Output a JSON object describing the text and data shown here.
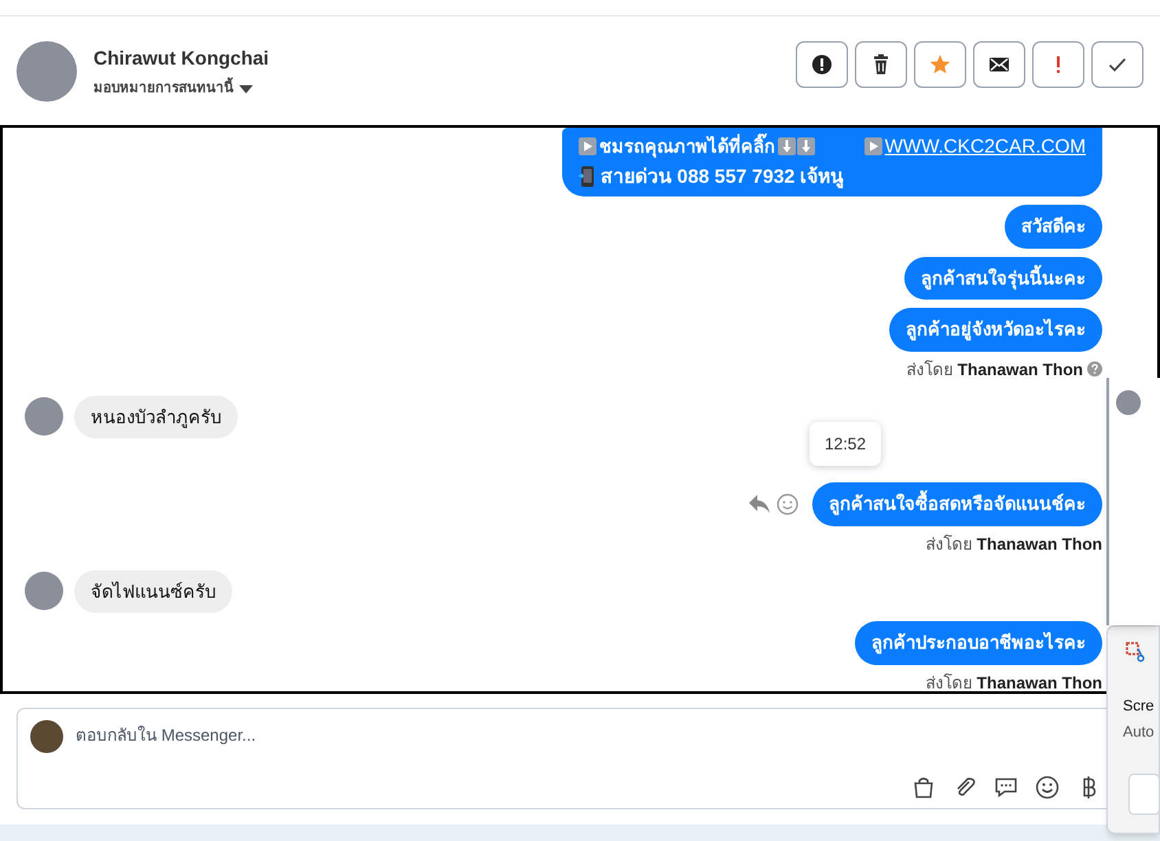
{
  "header": {
    "name": "Chirawut Kongchai",
    "subtitle": "มอบหมายการสนทนานี้",
    "actions": [
      {
        "kind": "alert"
      },
      {
        "kind": "trash"
      },
      {
        "kind": "star"
      },
      {
        "kind": "mail"
      },
      {
        "kind": "important"
      },
      {
        "kind": "check"
      }
    ]
  },
  "messages": [
    {
      "kind": "promo",
      "line_1": "ชมรถคุณภาพได้ที่คลิ๊ก",
      "link": "WWW.CKC2CAR.COM",
      "line_2": "สายด่วน 088 557 7932 เจ้หนู"
    },
    {
      "kind": "outgoing",
      "text": "สวัสดีคะ"
    },
    {
      "kind": "outgoing",
      "text": "ลูกค้าสนใจรุ่นนี้นะคะ"
    },
    {
      "kind": "outgoing",
      "text": "ลูกค้าอยู่จังหวัดอะไรคะ"
    },
    {
      "kind": "sent_by",
      "text": "ส่งโดย **Thanawan Thon**",
      "info_icon": true
    },
    {
      "kind": "incoming",
      "text": "หนองบัวลำภูครับ"
    },
    {
      "kind": "outgoing",
      "text": "ลูกค้าสนใจซื้อสดหรือจัดแนนช์คะ",
      "hover_actions": true,
      "time_tooltip": "12:52"
    },
    {
      "kind": "sent_by",
      "text": "ส่งโดย **Thanawan Thon**",
      "info_icon": false
    },
    {
      "kind": "incoming",
      "text": "จัดไฟแนนซ์ครับ"
    },
    {
      "kind": "outgoing",
      "text": "ลูกค้าประกอบอาชีพอะไรคะ"
    },
    {
      "kind": "sent_by",
      "text": "ส่งโดย **Thanawan Thon**",
      "info_icon": false
    }
  ],
  "composer": {
    "placeholder": "ตอบกลับใน Messenger...",
    "tools": [
      {
        "kind": "bag"
      },
      {
        "kind": "clip"
      },
      {
        "kind": "chat"
      },
      {
        "kind": "emoji"
      },
      {
        "kind": "baht"
      }
    ]
  },
  "overlay_window": {
    "lines": [
      "Scre",
      "Auto"
    ]
  }
}
